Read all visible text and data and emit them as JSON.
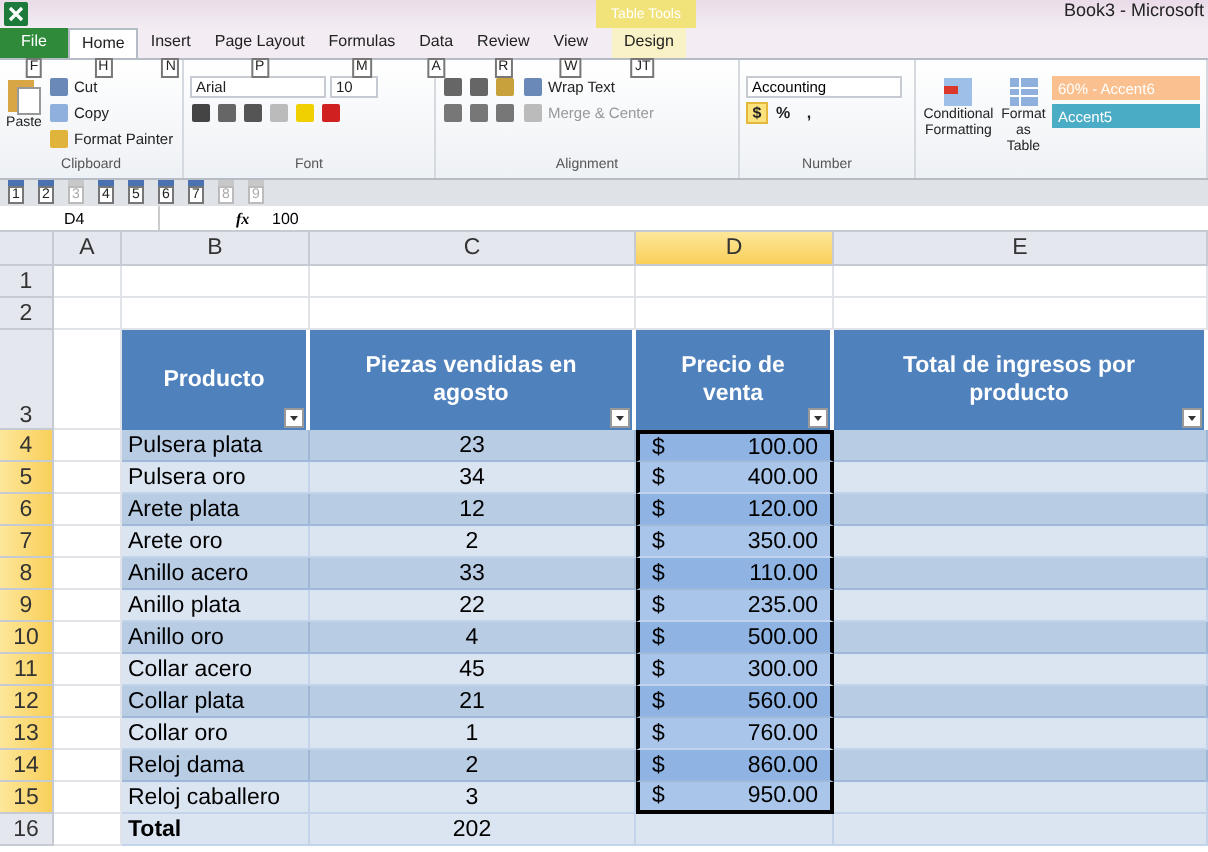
{
  "window": {
    "title": "Book3 - Microsoft",
    "contextual_label": "Table Tools"
  },
  "tabs": [
    {
      "label": "File",
      "keytip": "F",
      "kind": "file",
      "selected": false
    },
    {
      "label": "Home",
      "keytip": "H",
      "kind": "normal",
      "selected": true
    },
    {
      "label": "Insert",
      "keytip": "N",
      "kind": "normal",
      "selected": false
    },
    {
      "label": "Page Layout",
      "keytip": "P",
      "kind": "normal",
      "selected": false
    },
    {
      "label": "Formulas",
      "keytip": "M",
      "kind": "normal",
      "selected": false
    },
    {
      "label": "Data",
      "keytip": "A",
      "kind": "normal",
      "selected": false
    },
    {
      "label": "Review",
      "keytip": "R",
      "kind": "normal",
      "selected": false
    },
    {
      "label": "View",
      "keytip": "W",
      "kind": "normal",
      "selected": false
    },
    {
      "label": "Design",
      "keytip": "JT",
      "kind": "contextual",
      "selected": false
    }
  ],
  "ribbon": {
    "clipboard": {
      "paste": "Paste",
      "cut": "Cut",
      "copy": "Copy",
      "format_painter": "Format Painter",
      "label": "Clipboard"
    },
    "font": {
      "name": "Arial",
      "size": "10",
      "label": "Font"
    },
    "alignment": {
      "wrap": "Wrap Text",
      "merge": "Merge & Center",
      "merge_disabled": true,
      "label": "Alignment"
    },
    "number": {
      "format": "Accounting",
      "currency": "$",
      "percent": "%",
      "comma": ",",
      "label": "Number"
    },
    "styles": {
      "conditional": "Conditional Formatting",
      "format_table": "Format as Table",
      "cell_styles": [
        {
          "label": "60% - Accent6",
          "color": "#fbc08f"
        },
        {
          "label": "Accent5",
          "color": "#4bacc6"
        }
      ]
    }
  },
  "quick_access": [
    {
      "keytip": "1",
      "disabled": false
    },
    {
      "keytip": "2",
      "disabled": false
    },
    {
      "keytip": "3",
      "disabled": true
    },
    {
      "keytip": "4",
      "disabled": false
    },
    {
      "keytip": "5",
      "disabled": false
    },
    {
      "keytip": "6",
      "disabled": false
    },
    {
      "keytip": "7",
      "disabled": false
    },
    {
      "keytip": "8",
      "disabled": true
    },
    {
      "keytip": "9",
      "disabled": true
    }
  ],
  "formula_bar": {
    "name_box": "D4",
    "fx": "fx",
    "value": "100"
  },
  "sheet": {
    "columns": [
      {
        "label": "A",
        "selected": false
      },
      {
        "label": "B",
        "selected": false
      },
      {
        "label": "C",
        "selected": false
      },
      {
        "label": "D",
        "selected": true
      },
      {
        "label": "E",
        "selected": false
      }
    ],
    "headers": [
      "Producto",
      "Piezas vendidas en agosto",
      "Precio de venta",
      "Total de ingresos por producto"
    ],
    "rows": [
      {
        "num": "4",
        "product": "Pulsera plata",
        "pieces": "23",
        "currency": "$",
        "price": "100.00",
        "selected": true
      },
      {
        "num": "5",
        "product": "Pulsera oro",
        "pieces": "34",
        "currency": "$",
        "price": "400.00",
        "selected": true
      },
      {
        "num": "6",
        "product": "Arete plata",
        "pieces": "12",
        "currency": "$",
        "price": "120.00",
        "selected": true
      },
      {
        "num": "7",
        "product": "Arete oro",
        "pieces": "2",
        "currency": "$",
        "price": "350.00",
        "selected": true
      },
      {
        "num": "8",
        "product": "Anillo acero",
        "pieces": "33",
        "currency": "$",
        "price": "110.00",
        "selected": true
      },
      {
        "num": "9",
        "product": "Anillo plata",
        "pieces": "22",
        "currency": "$",
        "price": "235.00",
        "selected": true
      },
      {
        "num": "10",
        "product": "Anillo oro",
        "pieces": "4",
        "currency": "$",
        "price": "500.00",
        "selected": true
      },
      {
        "num": "11",
        "product": "Collar acero",
        "pieces": "45",
        "currency": "$",
        "price": "300.00",
        "selected": true
      },
      {
        "num": "12",
        "product": "Collar plata",
        "pieces": "21",
        "currency": "$",
        "price": "560.00",
        "selected": true
      },
      {
        "num": "13",
        "product": "Collar oro",
        "pieces": "1",
        "currency": "$",
        "price": "760.00",
        "selected": true
      },
      {
        "num": "14",
        "product": "Reloj dama",
        "pieces": "2",
        "currency": "$",
        "price": "860.00",
        "selected": true
      },
      {
        "num": "15",
        "product": "Reloj caballero",
        "pieces": "3",
        "currency": "$",
        "price": "950.00",
        "selected": true
      }
    ],
    "total": {
      "num": "16",
      "label": "Total",
      "pieces": "202"
    },
    "blank_rows": [
      "1",
      "2"
    ],
    "header_row": "3"
  }
}
